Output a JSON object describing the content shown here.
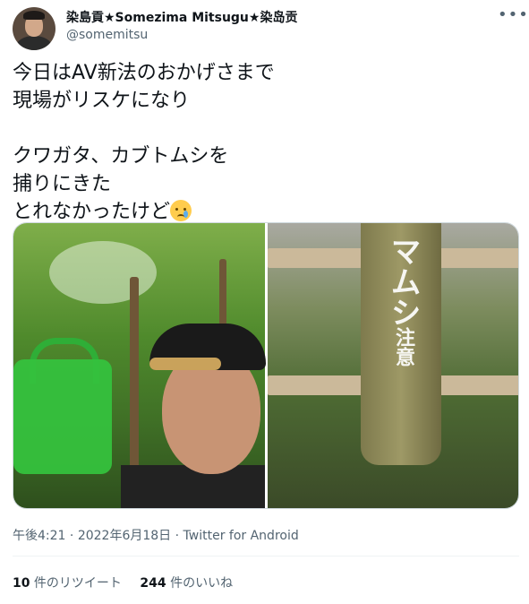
{
  "author": {
    "name": "染島貢★Somezima Mitsugu★染岛贡",
    "handle": "@somemitsu"
  },
  "more_icon": "more-dots-icon",
  "tweet": {
    "text": "今日はAV新法のおかげさまで\n現場がリスケになり\n\nクワガタ、カブトムシを\n捕りにきた\nとれなかったけど",
    "emoji": "crying-face-emoji"
  },
  "media": {
    "photo_left": "selfie-with-green-basket",
    "photo_right": "wooden-post-sign",
    "sign_text_large": "マムシ",
    "sign_text_small": "注意"
  },
  "meta": {
    "time": "午後4:21",
    "separator1": " · ",
    "date": "2022年6月18日",
    "separator2": " · ",
    "source": "Twitter for Android"
  },
  "stats": {
    "retweets_count": "10",
    "retweets_label": " 件のリツイート",
    "likes_count": "244",
    "likes_label": " 件のいいね"
  }
}
